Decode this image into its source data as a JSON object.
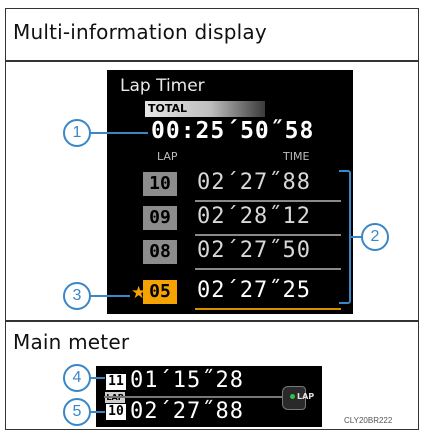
{
  "sections": {
    "mid_title": "Multi-information display",
    "meter_title": "Main meter"
  },
  "mid": {
    "screen_title": "Lap Timer",
    "total_label": "TOTAL",
    "total_time": "00:25´50˝58",
    "col_lap": "LAP",
    "col_time": "TIME",
    "rows": [
      {
        "lap": "10",
        "time": "02´27˝88",
        "best": false
      },
      {
        "lap": "09",
        "time": "02´28˝12",
        "best": false
      },
      {
        "lap": "08",
        "time": "02´27˝50",
        "best": false
      },
      {
        "lap": "05",
        "time": "02´27˝25",
        "best": true
      }
    ],
    "best_marker": "★"
  },
  "meter": {
    "current_lap": "11",
    "current_time": "01´15˝28",
    "lap_tag": "LAP",
    "prev_lap": "10",
    "prev_time": "02´27˝88",
    "switch_label": "LAP"
  },
  "callouts": [
    "1",
    "2",
    "3",
    "4",
    "5"
  ],
  "image_code": "CLY20BR222",
  "colors": {
    "accent_blue": "#3a87c8",
    "best_orange": "#f5a300",
    "lap_gray": "#8c8c8c"
  }
}
